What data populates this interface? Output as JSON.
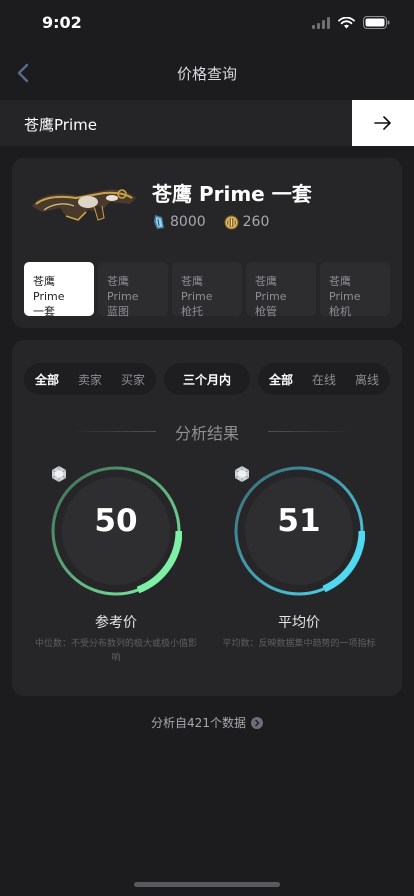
{
  "status": {
    "time": "9:02"
  },
  "nav": {
    "title": "价格查询"
  },
  "search": {
    "value": "苍鹰Prime"
  },
  "item": {
    "name": "苍鹰 Prime 一套",
    "ducats": "8000",
    "platinum": "260",
    "variants": [
      {
        "line1": "苍鹰 Prime",
        "line2": "一套",
        "active": true
      },
      {
        "line1": "苍鹰 Prime",
        "line2": "蓝图",
        "active": false
      },
      {
        "line1": "苍鹰 Prime",
        "line2": "枪托",
        "active": false
      },
      {
        "line1": "苍鹰 Prime",
        "line2": "枪管",
        "active": false
      },
      {
        "line1": "苍鹰 Prime",
        "line2": "枪机",
        "active": false
      }
    ]
  },
  "filters": {
    "side": {
      "all": "全部",
      "seller": "卖家",
      "buyer": "买家"
    },
    "period": "三个月内",
    "status": {
      "all": "全部",
      "online": "在线",
      "offline": "离线"
    }
  },
  "analysis": {
    "title": "分析结果",
    "reference": {
      "value": "50",
      "label": "参考价",
      "desc": "中位数：不受分布数列的极大或极小值影响"
    },
    "average": {
      "value": "51",
      "label": "平均价",
      "desc": "平均数：反映数据集中趋势的一项指标"
    }
  },
  "footer": {
    "text": "分析自421个数据"
  },
  "colors": {
    "refGauge": "#7ef0a6",
    "avgGauge": "#4fd8f0",
    "background": "#1c1c1e",
    "card": "#262628"
  }
}
